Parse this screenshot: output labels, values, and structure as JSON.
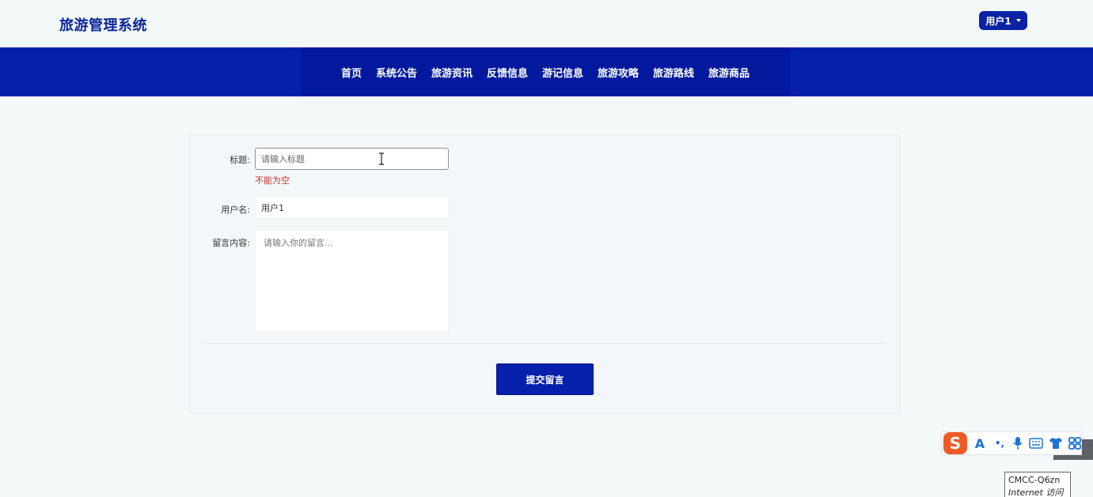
{
  "header": {
    "brand": "旅游管理系统",
    "user_menu_label": "用户1"
  },
  "nav": {
    "items": [
      "首页",
      "系统公告",
      "旅游资讯",
      "反馈信息",
      "游记信息",
      "旅游攻略",
      "旅游路线",
      "旅游商品"
    ]
  },
  "form": {
    "title_label": "标题:",
    "title_placeholder": "请输入标题",
    "title_error": "不能为空",
    "username_label": "用户名:",
    "username_value": "用户1",
    "content_label": "留言内容:",
    "content_placeholder": "请输入你的留言...",
    "submit_label": "提交留言"
  },
  "ime_toolbar": {
    "logo": "S",
    "icons": [
      "font-icon",
      "punctuation-icon",
      "microphone-icon",
      "keyboard-icon",
      "skin-icon",
      "apps-icon"
    ],
    "font_glyph": "A",
    "punct_glyph": "•,",
    "accent": "#ef5a24"
  },
  "network_tooltip": {
    "ssid": "CMCC-Q6zn",
    "status": "Internet 访问"
  },
  "colors": {
    "primary": "#0620ab",
    "brand_text": "#0b2499",
    "error": "#c9302c",
    "background": "#f3f8f9"
  }
}
